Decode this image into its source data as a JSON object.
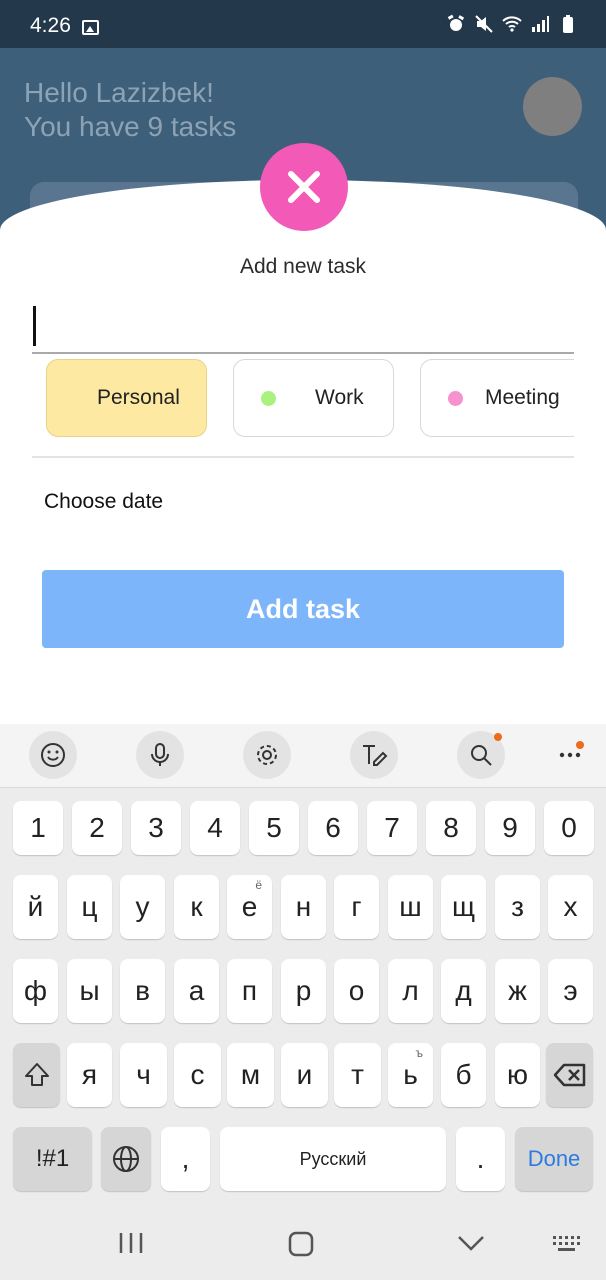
{
  "status_bar": {
    "time": "4:26",
    "icons": [
      "image-icon",
      "alarm-icon",
      "mute-icon",
      "wifi-icon",
      "signal-icon",
      "battery-icon"
    ]
  },
  "header": {
    "greeting_line1": "Hello Lazizbek!",
    "greeting_line2": "You have 9 tasks"
  },
  "sheet": {
    "title": "Add new task",
    "task_input_value": "",
    "categories": [
      {
        "label": "Personal",
        "color": "#fde9a1",
        "selected": true
      },
      {
        "label": "Work",
        "color": "#a9f27f",
        "selected": false
      },
      {
        "label": "Meeting",
        "color": "#f592cf",
        "selected": false
      }
    ],
    "choose_date": "Choose date",
    "add_button": "Add task"
  },
  "colors": {
    "close_button": "#f35ab8",
    "add_button": "#7db5fa",
    "header_bg": "#3e5f7a"
  },
  "keyboard": {
    "toolbar": [
      "emoji-icon",
      "microphone-icon",
      "settings-icon",
      "handwriting-icon",
      "search-icon",
      "more-icon"
    ],
    "rows": [
      [
        "1",
        "2",
        "3",
        "4",
        "5",
        "6",
        "7",
        "8",
        "9",
        "0"
      ],
      [
        "й",
        "ц",
        "у",
        "к",
        "е",
        "н",
        "г",
        "ш",
        "щ",
        "з",
        "х"
      ],
      [
        "ф",
        "ы",
        "в",
        "а",
        "п",
        "р",
        "о",
        "л",
        "д",
        "ж",
        "э"
      ],
      [
        "я",
        "ч",
        "с",
        "м",
        "и",
        "т",
        "ь",
        "б",
        "ю"
      ]
    ],
    "hints": {
      "e": "ё",
      "soft": "ъ"
    },
    "symbols_key": "!#1",
    "comma": ",",
    "space": "Русский",
    "period": ".",
    "done": "Done"
  }
}
